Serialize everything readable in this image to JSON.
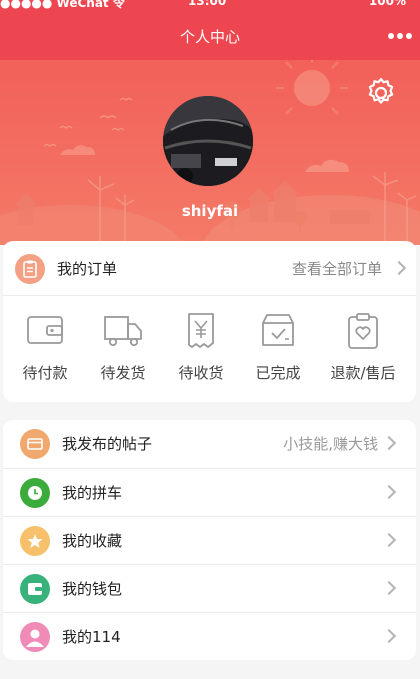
{
  "status_bar": {
    "carrier": "●●●●● WeChat 令",
    "time": "13:00",
    "battery": "100%"
  },
  "nav": {
    "title": "个人中心",
    "more_icon": "more-dots-icon"
  },
  "profile": {
    "username": "shiyfai",
    "settings_icon": "gear-icon",
    "avatar": "car-photo"
  },
  "orders": {
    "title": "我的订单",
    "view_all": "查看全部订单",
    "items": [
      {
        "label": "待付款",
        "icon": "wallet-icon"
      },
      {
        "label": "待发货",
        "icon": "truck-icon"
      },
      {
        "label": "待收货",
        "icon": "yen-receipt-icon"
      },
      {
        "label": "已完成",
        "icon": "box-check-icon"
      },
      {
        "label": "退款/售后",
        "icon": "clipboard-heart-icon"
      }
    ]
  },
  "menu": [
    {
      "label": "我发布的帖子",
      "extra": "小技能,赚大钱",
      "icon": "post-icon",
      "color": "#f0a86e"
    },
    {
      "label": "我的拼车",
      "extra": "",
      "icon": "clock-icon",
      "color": "#3bab3b"
    },
    {
      "label": "我的收藏",
      "extra": "",
      "icon": "star-icon",
      "color": "#f6c16a"
    },
    {
      "label": "我的钱包",
      "extra": "",
      "icon": "wallet-icon",
      "color": "#36b27a"
    },
    {
      "label": "我的114",
      "extra": "",
      "icon": "user-icon",
      "color": "#f08bb8"
    }
  ],
  "colors": {
    "primary": "#ee4650",
    "hero_top": "#f2605a",
    "hero_bottom": "#f47a66"
  }
}
